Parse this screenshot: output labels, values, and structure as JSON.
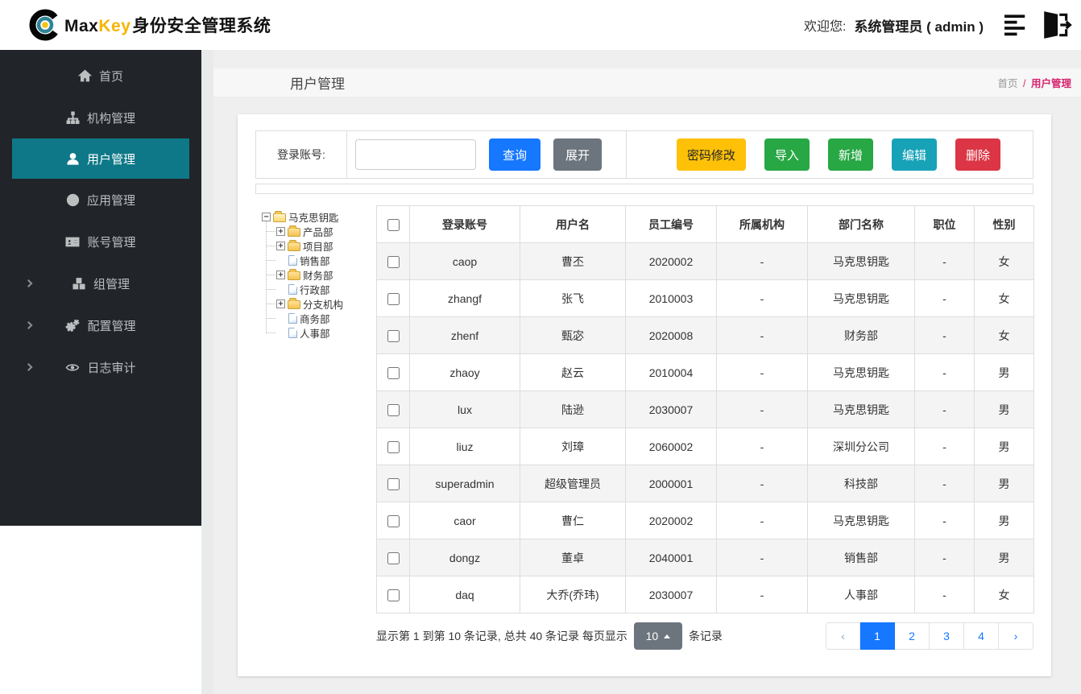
{
  "colors": {
    "sidebar_bg": "#212529",
    "active_item_teal": "#0e7888",
    "primary_blue": "#1677ff",
    "breadcrumb_pink": "#d6246e",
    "warning": "#ffc107",
    "success": "#28a745",
    "info": "#17a2b8",
    "danger": "#dc3545",
    "secondary": "#6c757d"
  },
  "header": {
    "logo": {
      "max": "Max",
      "key": "Key",
      "suffix": "身份安全管理系统"
    },
    "welcome_label": "欢迎您:",
    "username": "系统管理员 ( admin )"
  },
  "sidebar": {
    "items": [
      {
        "id": "home",
        "icon": "home-icon",
        "label": "首页",
        "active": false,
        "chevron": false
      },
      {
        "id": "org",
        "icon": "sitemap-icon",
        "label": "机构管理",
        "active": false,
        "chevron": false
      },
      {
        "id": "user",
        "icon": "user-icon",
        "label": "用户管理",
        "active": true,
        "chevron": false
      },
      {
        "id": "app",
        "icon": "globe-icon",
        "label": "应用管理",
        "active": false,
        "chevron": false
      },
      {
        "id": "account",
        "icon": "id-card-icon",
        "label": "账号管理",
        "active": false,
        "chevron": false
      },
      {
        "id": "group",
        "icon": "cubes-icon",
        "label": "组管理",
        "active": false,
        "chevron": true
      },
      {
        "id": "config",
        "icon": "gears-icon",
        "label": "配置管理",
        "active": false,
        "chevron": true
      },
      {
        "id": "audit",
        "icon": "eye-icon",
        "label": "日志审计",
        "active": false,
        "chevron": true
      }
    ]
  },
  "titlebar": {
    "title": "用户管理",
    "breadcrumb": {
      "home": "首页",
      "separator": "/",
      "current": "用户管理"
    }
  },
  "toolbar": {
    "search_label": "登录账号:",
    "search_value": "",
    "query_label": "查询",
    "expand_label": "展开",
    "actions": [
      {
        "name": "change-password-button",
        "label": "密码修改",
        "bg": "#ffc107",
        "fg": "#212529"
      },
      {
        "name": "import-button",
        "label": "导入",
        "bg": "#28a745",
        "fg": "#ffffff"
      },
      {
        "name": "add-button",
        "label": "新增",
        "bg": "#28a745",
        "fg": "#ffffff"
      },
      {
        "name": "edit-button",
        "label": "编辑",
        "bg": "#17a2b8",
        "fg": "#ffffff"
      },
      {
        "name": "delete-button",
        "label": "删除",
        "bg": "#dc3545",
        "fg": "#ffffff"
      }
    ]
  },
  "tree": {
    "nodes": [
      {
        "label": "马克思钥匙",
        "level": 0,
        "expander": "minus",
        "icon": "folder-open"
      },
      {
        "label": "产品部",
        "level": 1,
        "expander": "plus",
        "icon": "folder"
      },
      {
        "label": "项目部",
        "level": 1,
        "expander": "plus",
        "icon": "folder"
      },
      {
        "label": "销售部",
        "level": 1,
        "expander": "none",
        "icon": "file"
      },
      {
        "label": "财务部",
        "level": 1,
        "expander": "plus",
        "icon": "folder"
      },
      {
        "label": "行政部",
        "level": 1,
        "expander": "none",
        "icon": "file"
      },
      {
        "label": "分支机构",
        "level": 1,
        "expander": "plus",
        "icon": "folder"
      },
      {
        "label": "商务部",
        "level": 1,
        "expander": "none",
        "icon": "file"
      },
      {
        "label": "人事部",
        "level": 1,
        "expander": "none",
        "icon": "file"
      }
    ]
  },
  "table": {
    "headers": [
      "登录账号",
      "用户名",
      "员工编号",
      "所属机构",
      "部门名称",
      "职位",
      "性别"
    ],
    "rows": [
      {
        "cells": [
          "caop",
          "曹丕",
          "2020002",
          "-",
          "马克思钥匙",
          "-",
          "女"
        ]
      },
      {
        "cells": [
          "zhangf",
          "张飞",
          "2010003",
          "-",
          "马克思钥匙",
          "-",
          "女"
        ]
      },
      {
        "cells": [
          "zhenf",
          "甄宓",
          "2020008",
          "-",
          "财务部",
          "-",
          "女"
        ]
      },
      {
        "cells": [
          "zhaoy",
          "赵云",
          "2010004",
          "-",
          "马克思钥匙",
          "-",
          "男"
        ]
      },
      {
        "cells": [
          "lux",
          "陆逊",
          "2030007",
          "-",
          "马克思钥匙",
          "-",
          "男"
        ]
      },
      {
        "cells": [
          "liuz",
          "刘璋",
          "2060002",
          "-",
          "深圳分公司",
          "-",
          "男"
        ]
      },
      {
        "cells": [
          "superadmin",
          "超级管理员",
          "2000001",
          "-",
          "科技部",
          "-",
          "男"
        ]
      },
      {
        "cells": [
          "caor",
          "曹仁",
          "2020002",
          "-",
          "马克思钥匙",
          "-",
          "男"
        ]
      },
      {
        "cells": [
          "dongz",
          "董卓",
          "2040001",
          "-",
          "销售部",
          "-",
          "男"
        ]
      },
      {
        "cells": [
          "daq",
          "大乔(乔玮)",
          "2030007",
          "-",
          "人事部",
          "-",
          "女"
        ]
      }
    ]
  },
  "pagination": {
    "info_prefix": "显示第 1 到第 10 条记录, 总共 40 条记录 每页显示",
    "page_size": "10",
    "info_suffix": "条记录",
    "prev": "‹",
    "next": "›",
    "pages": [
      "1",
      "2",
      "3",
      "4"
    ],
    "active": "1"
  }
}
